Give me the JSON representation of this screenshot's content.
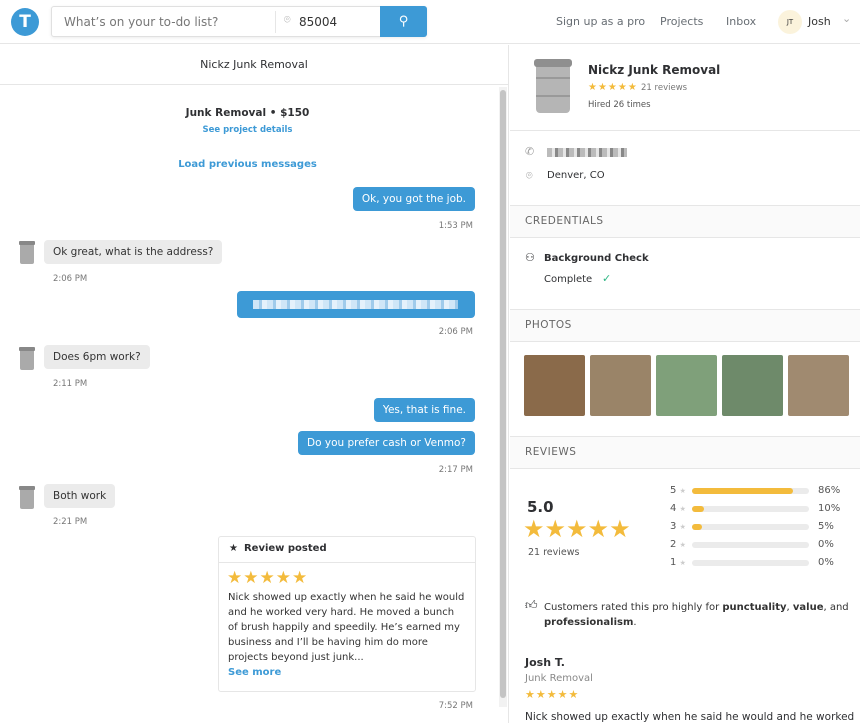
{
  "header": {
    "logo": "T",
    "search_placeholder": "What’s on your to-do list?",
    "zip": "85004",
    "nav": [
      "Sign up as a pro",
      "Projects",
      "Inbox"
    ],
    "avatar_initials": "JT",
    "user_name": "Josh"
  },
  "chat": {
    "title": "Nickz Junk Removal",
    "project": "Junk Removal • $150",
    "project_link": "See project details",
    "load_previous": "Load previous messages",
    "messages": [
      {
        "from": "me",
        "text": "Ok, you got the job.",
        "time": "1:53 PM"
      },
      {
        "from": "pro",
        "text": "Ok great, what is the address?",
        "time": "2:06 PM"
      },
      {
        "from": "me",
        "text": "",
        "time": "2:06 PM"
      },
      {
        "from": "pro",
        "text": "Does 6pm work?",
        "time": "2:11 PM"
      },
      {
        "from": "me",
        "text": "Yes, that is fine.",
        "time": ""
      },
      {
        "from": "me",
        "text": "Do you prefer cash or Venmo?",
        "time": "2:17 PM"
      },
      {
        "from": "pro",
        "text": "Both work",
        "time": "2:21 PM"
      }
    ],
    "review": {
      "title": "Review posted",
      "stars": "★★★★★",
      "text": "Nick showed up exactly when he said he would and he worked very hard. He moved a bunch of brush happily and speedily. He’s earned my business and I’ll be having him do more projects beyond just junk...",
      "see_more": "See more",
      "time": "7:52 PM"
    }
  },
  "pro": {
    "name": "Nickz Junk Removal",
    "stars": "★★★★★",
    "reviews": "21 reviews",
    "hired": "Hired 26 times",
    "location": "Denver, CO",
    "credentials_heading": "CREDENTIALS",
    "credential": "Background Check",
    "credential_status": "Complete",
    "photos_heading": "PHOTOS",
    "photo_colors": [
      "#8a6a4a",
      "#9a8468",
      "#7fa07a",
      "#6e8a6a",
      "#a08a70"
    ],
    "reviews_heading": "REVIEWS",
    "rating": "5.0",
    "rating_stars": "★★★★★",
    "rating_count": "21 reviews",
    "distribution": [
      {
        "star": "5",
        "pct": 86,
        "label": "86%"
      },
      {
        "star": "4",
        "pct": 10,
        "label": "10%"
      },
      {
        "star": "3",
        "pct": 5,
        "label": "5%"
      },
      {
        "star": "2",
        "pct": 0,
        "label": "0%"
      },
      {
        "star": "1",
        "pct": 0,
        "label": "0%"
      }
    ],
    "highlight_pre": "Customers rated this pro highly for ",
    "h1": "punctuality",
    "sep1": ", ",
    "h2": "value",
    "sep2": ", and ",
    "h3": "professionalism",
    "end": ".",
    "review_author": "Josh T.",
    "review_service": "Junk Removal",
    "review_stars": "★★★★★",
    "review_text": "Nick showed up exactly when he said he would and he worked"
  },
  "colors": {
    "accent": "#3d9ad6",
    "star": "#f3bb3c"
  }
}
